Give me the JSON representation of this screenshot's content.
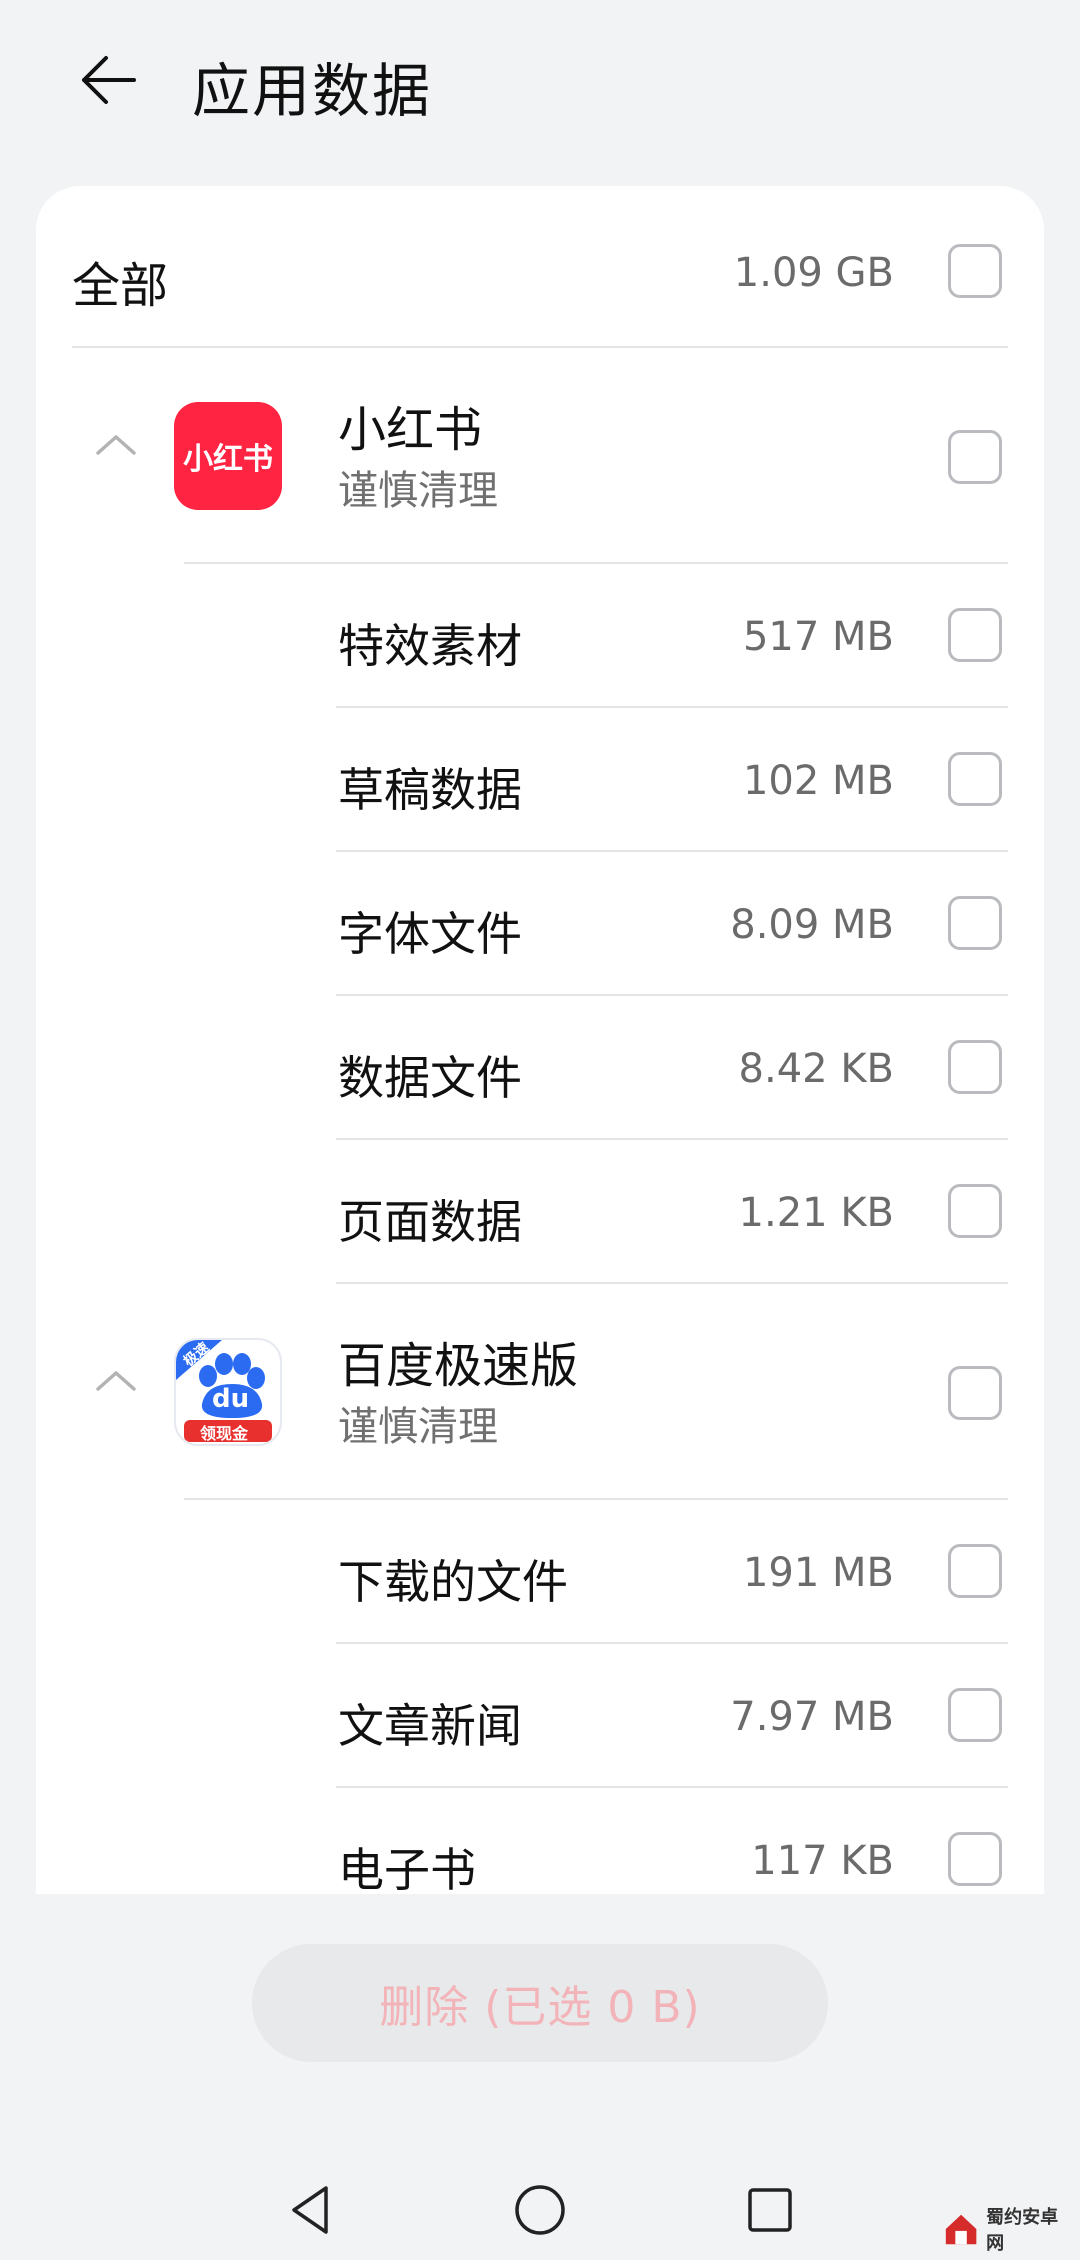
{
  "header": {
    "title": "应用数据"
  },
  "all": {
    "label": "全部",
    "size": "1.09 GB"
  },
  "apps": [
    {
      "name": "小红书",
      "note": "谨慎清理",
      "icon_text": "小红书",
      "icon_color": "#ff2442",
      "items": [
        {
          "label": "特效素材",
          "size": "517 MB"
        },
        {
          "label": "草稿数据",
          "size": "102 MB"
        },
        {
          "label": "字体文件",
          "size": "8.09 MB"
        },
        {
          "label": "数据文件",
          "size": "8.42 KB"
        },
        {
          "label": "页面数据",
          "size": "1.21 KB"
        }
      ]
    },
    {
      "name": "百度极速版",
      "note": "谨慎清理",
      "icon_text_top": "极速",
      "icon_text_mid": "du",
      "icon_text_bottom": "领现金",
      "icon_color": "#2a6bf2",
      "items": [
        {
          "label": "下载的文件",
          "size": "191 MB"
        },
        {
          "label": "文章新闻",
          "size": "7.97 MB"
        },
        {
          "label": "电子书",
          "size": "117 KB"
        }
      ]
    }
  ],
  "footer": {
    "delete_label": "删除 (已选 0 B)"
  },
  "nav": {
    "back": "back-triangle-icon",
    "home": "home-circle-icon",
    "recent": "recent-square-icon"
  },
  "watermark": {
    "text": "蜀约安卓网"
  }
}
